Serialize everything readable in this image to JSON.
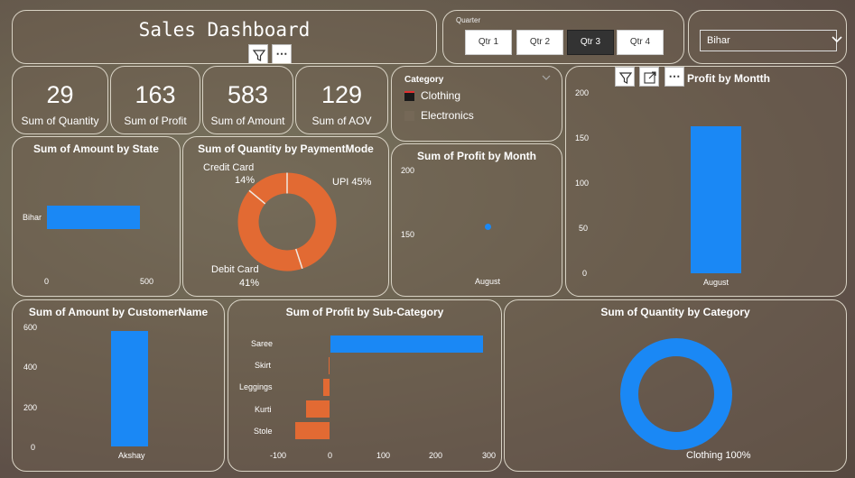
{
  "title": "Sales Dashboard",
  "quarter_slicer": {
    "label": "Quarter",
    "options": [
      "Qtr 1",
      "Qtr 2",
      "Qtr 3",
      "Qtr 4"
    ],
    "selected": "Qtr 3"
  },
  "state_dropdown": {
    "value": "Bihar"
  },
  "kpis": [
    {
      "value": "29",
      "label": "Sum of Quantity"
    },
    {
      "value": "163",
      "label": "Sum of Profit"
    },
    {
      "value": "583",
      "label": "Sum of Amount"
    },
    {
      "value": "129",
      "label": "Sum of AOV"
    }
  ],
  "category_legend": {
    "title": "Category",
    "items": [
      "Clothing",
      "Electronics"
    ]
  },
  "profit_by_month_big": {
    "title": "Profit by Montth"
  },
  "colors": {
    "blue": "#1a88f5",
    "orange": "#e26a33"
  },
  "chart_data": [
    {
      "type": "bar",
      "title": "Sum of Amount by State",
      "categories": [
        "Bihar"
      ],
      "values": [
        583
      ],
      "xlim": [
        0,
        600
      ],
      "xticks": [
        "0",
        "500"
      ]
    },
    {
      "type": "pie",
      "title": "Sum of Quantity by PaymentMode",
      "labels": [
        "UPI",
        "Debit Card",
        "Credit Card"
      ],
      "values": [
        45,
        41,
        14
      ],
      "label_texts": [
        "UPI 45%",
        "Debit Card",
        "41%",
        "Credit Card",
        "14%"
      ]
    },
    {
      "type": "scatter",
      "title": "Sum of Profit by Month",
      "x": [
        "August"
      ],
      "y": [
        163
      ],
      "ylim": [
        135,
        210
      ],
      "yticks": [
        "200",
        "150"
      ]
    },
    {
      "type": "bar",
      "title": "Profit by Montth",
      "categories": [
        "August"
      ],
      "values": [
        163
      ],
      "ylim": [
        0,
        200
      ],
      "yticks": [
        "200",
        "150",
        "100",
        "50",
        "0"
      ]
    },
    {
      "type": "bar",
      "title": "Sum of Amount by CustomerName",
      "categories": [
        "Akshay"
      ],
      "values": [
        583
      ],
      "ylim": [
        0,
        600
      ],
      "yticks": [
        "600",
        "400",
        "200",
        "0"
      ]
    },
    {
      "type": "bar",
      "title": "Sum of Profit by Sub-Category",
      "categories": [
        "Saree",
        "Skirt",
        "Leggings",
        "Kurti",
        "Stole"
      ],
      "values": [
        290,
        -2,
        -13,
        -45,
        -65
      ],
      "xlim": [
        -100,
        300
      ],
      "xticks": [
        "-100",
        "0",
        "100",
        "200",
        "300"
      ]
    },
    {
      "type": "pie",
      "title": "Sum of Quantity by Category",
      "labels": [
        "Clothing"
      ],
      "values": [
        100
      ],
      "label_texts": [
        "Clothing 100%"
      ]
    }
  ]
}
